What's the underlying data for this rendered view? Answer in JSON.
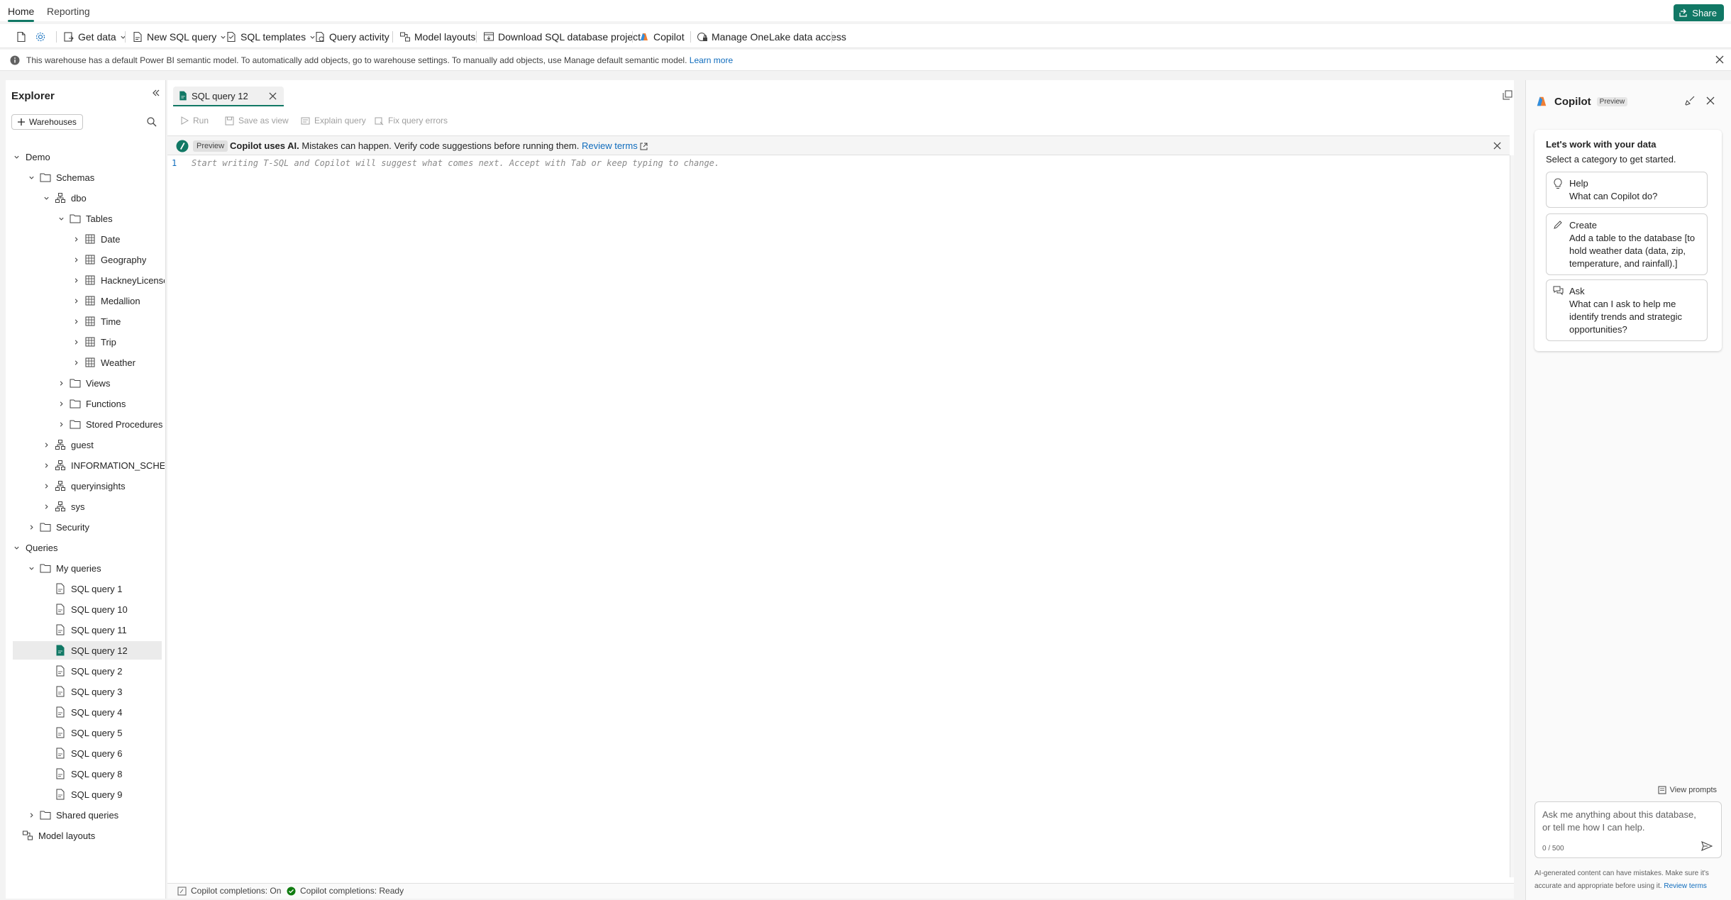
{
  "top_tabs": {
    "home": "Home",
    "reporting": "Reporting",
    "share": "Share"
  },
  "ribbon": {
    "get_data": "Get data",
    "new_sql_query": "New SQL query",
    "sql_templates": "SQL templates",
    "query_activity": "Query activity",
    "model_layouts": "Model layouts",
    "download_project": "Download SQL database project",
    "copilot": "Copilot",
    "manage_onelake": "Manage OneLake data access"
  },
  "info_bar": {
    "message": "This warehouse has a default Power BI semantic model. To automatically add objects, go to warehouse settings. To manually add objects, use Manage default semantic model.",
    "link": "Learn more"
  },
  "explorer": {
    "title": "Explorer",
    "warehouses_button": "Warehouses",
    "tree": {
      "demo": "Demo",
      "schemas": "Schemas",
      "dbo": "dbo",
      "tables": "Tables",
      "table_items": [
        "Date",
        "Geography",
        "HackneyLicense",
        "Medallion",
        "Time",
        "Trip",
        "Weather"
      ],
      "views": "Views",
      "functions": "Functions",
      "stored_procedures": "Stored Procedures",
      "guest": "guest",
      "information_schema": "INFORMATION_SCHEMA",
      "queryinsights": "queryinsights",
      "sys": "sys",
      "security": "Security",
      "queries": "Queries",
      "my_queries": "My queries",
      "query_items": [
        "SQL query 1",
        "SQL query 10",
        "SQL query 11",
        "SQL query 12",
        "SQL query 2",
        "SQL query 3",
        "SQL query 4",
        "SQL query 5",
        "SQL query 6",
        "SQL query 8",
        "SQL query 9"
      ],
      "selected_query": "SQL query 12",
      "shared_queries": "Shared queries",
      "model_layouts": "Model layouts"
    }
  },
  "editor": {
    "tab_label": "SQL query 12",
    "toolbar": {
      "run": "Run",
      "save_as_view": "Save as view",
      "explain_query": "Explain query",
      "fix_query_errors": "Fix query errors"
    },
    "preview": {
      "badge": "Preview",
      "bold": "Copilot uses AI.",
      "text": "Mistakes can happen. Verify code suggestions before running them.",
      "link": "Review terms"
    },
    "line_number": "1",
    "placeholder": "Start writing T-SQL and Copilot will suggest what comes next. Accept with Tab or keep typing to change.",
    "status": {
      "completions_on": "Copilot completions: On",
      "completions_ready": "Copilot completions: Ready"
    }
  },
  "copilot": {
    "title": "Copilot",
    "badge": "Preview",
    "card_heading": "Let's work with your data",
    "card_subheading": "Select a category to get started.",
    "options": [
      {
        "title": "Help",
        "text": "What can Copilot do?"
      },
      {
        "title": "Create",
        "text": "Add a table to the database [to hold weather data (data, zip, temperature, and rainfall).]"
      },
      {
        "title": "Ask",
        "text": "What can I ask to help me identify trends and strategic opportunities?"
      }
    ],
    "view_prompts": "View prompts",
    "input_placeholder": "Ask me anything about this database, or tell me how I can help.",
    "char_count": "0 / 500",
    "footer": "AI-generated content can have mistakes. Make sure it's accurate and appropriate before using it.",
    "footer_link": "Review terms"
  },
  "colors": {
    "accent": "#117865",
    "link": "#0f6cbd"
  }
}
